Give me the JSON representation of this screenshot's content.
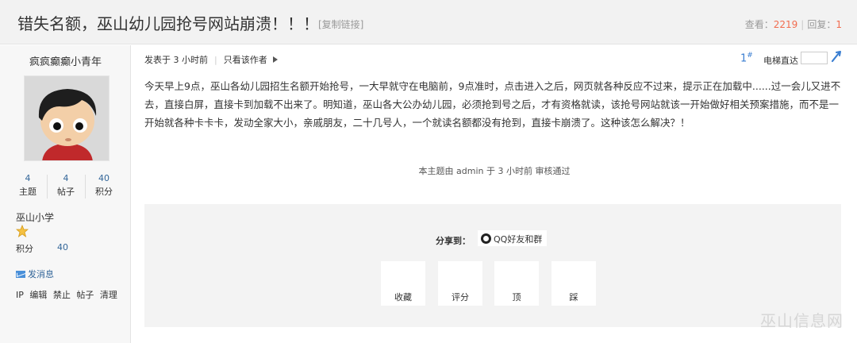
{
  "thread": {
    "title": "错失名额，巫山幼儿园抢号网站崩溃！！！",
    "copy_link": "[复制链接]",
    "views_label": "查看：",
    "views": "2219",
    "replies_label": "回复：",
    "replies": "1"
  },
  "author": {
    "name": "疯疯癫癫小青年",
    "stats": [
      {
        "value": "4",
        "label": "主题"
      },
      {
        "value": "4",
        "label": "帖子"
      },
      {
        "value": "40",
        "label": "积分"
      }
    ],
    "group": "巫山小学",
    "points_label": "积分",
    "points_value": "40",
    "send_message": "发消息",
    "admin_links": [
      "IP",
      "编辑",
      "禁止",
      "帖子",
      "清理"
    ]
  },
  "post": {
    "posted": "发表于 3 小时前",
    "only_author": "只看该作者",
    "floor": "1",
    "floor_mark": "#",
    "elevator_label": "电梯直达",
    "content": "今天早上9点，巫山各幼儿园招生名额开始抢号，一大早就守在电脑前，9点准时，点击进入之后，网页就各种反应不过来，提示正在加载中......过一会儿又进不去，直接白屏，直接卡到加载不出来了。明知道，巫山各大公办幼儿园，必须抢到号之后，才有资格就读，该抢号网站就该一开始做好相关预案措施，而不是一开始就各种卡卡卡，发动全家大小，亲戚朋友，二十几号人，一个就读名额都没有抢到，直接卡崩溃了。这种该怎么解决？！",
    "approval": "本主题由 admin 于 3 小时前 审核通过"
  },
  "share": {
    "label": "分享到：",
    "qq": "QQ好友和群"
  },
  "actions": [
    "收藏",
    "评分",
    "顶",
    "踩"
  ],
  "watermark": "巫山信息网",
  "colors": {
    "accent": "#f26c4f",
    "link": "#336699",
    "floor": "#3a7ed1"
  }
}
